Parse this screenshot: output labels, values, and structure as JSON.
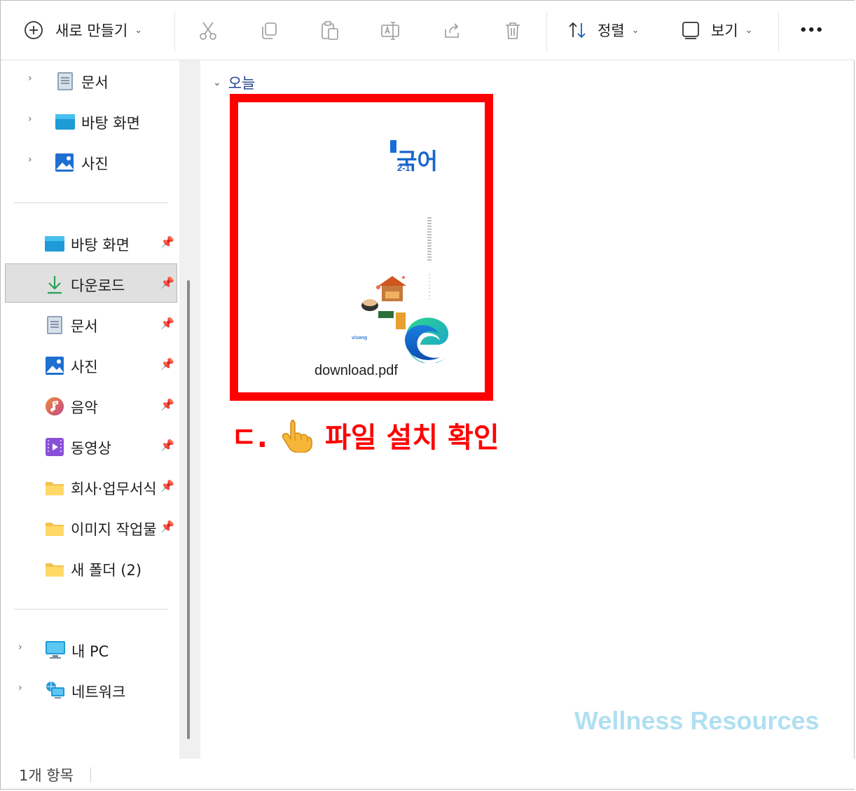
{
  "toolbar": {
    "new_label": "새로 만들기",
    "sort_label": "정렬",
    "view_label": "보기",
    "more_label": "•••"
  },
  "sidebar": {
    "top_items": [
      {
        "label": "문서",
        "icon": "document-icon"
      },
      {
        "label": "바탕 화면",
        "icon": "desktop-icon"
      },
      {
        "label": "사진",
        "icon": "pictures-icon"
      }
    ],
    "quick_access": [
      {
        "label": "바탕 화면",
        "icon": "desktop-icon",
        "pinned": true
      },
      {
        "label": "다운로드",
        "icon": "download-icon",
        "pinned": true,
        "selected": true
      },
      {
        "label": "문서",
        "icon": "document-icon",
        "pinned": true
      },
      {
        "label": "사진",
        "icon": "pictures-icon",
        "pinned": true
      },
      {
        "label": "음악",
        "icon": "music-icon",
        "pinned": true
      },
      {
        "label": "동영상",
        "icon": "video-icon",
        "pinned": true
      },
      {
        "label": "회사·업무서식",
        "icon": "folder-icon",
        "pinned": true
      },
      {
        "label": "이미지 작업물",
        "icon": "folder-icon",
        "pinned": true
      },
      {
        "label": "새 폴더 (2)",
        "icon": "folder-icon",
        "pinned": false
      }
    ],
    "bottom_items": [
      {
        "label": "내 PC",
        "icon": "pc-icon"
      },
      {
        "label": "네트워크",
        "icon": "network-icon"
      }
    ]
  },
  "content": {
    "group_label": "오늘",
    "file": {
      "name": "download.pdf",
      "thumb_title": "국어",
      "thumb_sub": "2-1",
      "thumb_publisher": "visang"
    }
  },
  "annotation": {
    "step": "ㄷ.",
    "text": "파일 설치 확인",
    "color": "#ff0000"
  },
  "watermark": "Wellness Resources",
  "status": {
    "item_count": "1개 항목"
  }
}
